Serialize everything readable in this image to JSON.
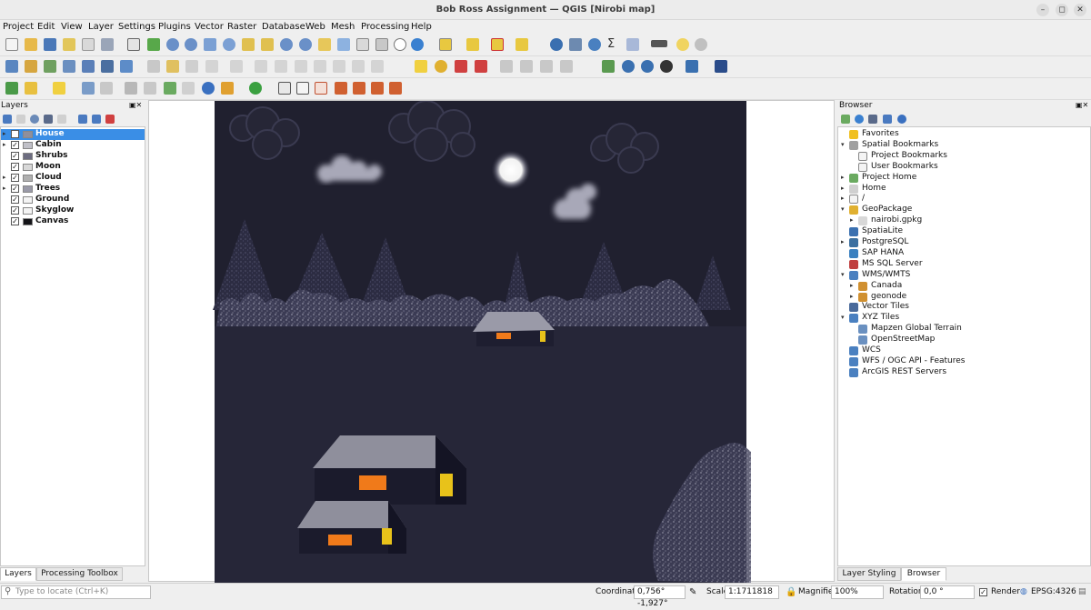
{
  "window": {
    "title": "Bob Ross Assignment — QGIS [Nirobi map]"
  },
  "menu": [
    "Project",
    "Edit",
    "View",
    "Layer",
    "Settings",
    "Plugins",
    "Vector",
    "Raster",
    "Database",
    "Web",
    "Mesh",
    "Processing",
    "Help"
  ],
  "layers_panel": {
    "title": "Layers",
    "items": [
      {
        "name": "House",
        "checked": true,
        "expandable": true,
        "selected": true
      },
      {
        "name": "Cabin",
        "checked": true,
        "expandable": true,
        "selected": false
      },
      {
        "name": "Shrubs",
        "checked": true,
        "expandable": false,
        "selected": false
      },
      {
        "name": "Moon",
        "checked": true,
        "expandable": false,
        "selected": false
      },
      {
        "name": "Cloud",
        "checked": true,
        "expandable": true,
        "selected": false
      },
      {
        "name": "Trees",
        "checked": true,
        "expandable": true,
        "selected": false
      },
      {
        "name": "Ground",
        "checked": true,
        "expandable": false,
        "selected": false
      },
      {
        "name": "Skyglow",
        "checked": true,
        "expandable": false,
        "selected": false
      },
      {
        "name": "Canvas",
        "checked": true,
        "expandable": false,
        "selected": false
      }
    ],
    "tabs": [
      "Layers",
      "Processing Toolbox"
    ]
  },
  "browser_panel": {
    "title": "Browser",
    "items": [
      {
        "label": "Favorites",
        "indent": 0,
        "arrow": "",
        "icon": "star-icon"
      },
      {
        "label": "Spatial Bookmarks",
        "indent": 0,
        "arrow": "▾",
        "icon": "bookmark-icon"
      },
      {
        "label": "Project Bookmarks",
        "indent": 1,
        "arrow": "",
        "icon": "folder-icon"
      },
      {
        "label": "User Bookmarks",
        "indent": 1,
        "arrow": "",
        "icon": "folder-icon"
      },
      {
        "label": "Project Home",
        "indent": 0,
        "arrow": "▸",
        "icon": "project-home-icon"
      },
      {
        "label": "Home",
        "indent": 0,
        "arrow": "▸",
        "icon": "home-icon"
      },
      {
        "label": "/",
        "indent": 0,
        "arrow": "▸",
        "icon": "folder-icon"
      },
      {
        "label": "GeoPackage",
        "indent": 0,
        "arrow": "▾",
        "icon": "geopackage-icon"
      },
      {
        "label": "nairobi.gpkg",
        "indent": 1,
        "arrow": "▸",
        "icon": "database-icon"
      },
      {
        "label": "SpatiaLite",
        "indent": 0,
        "arrow": "",
        "icon": "spatialite-icon"
      },
      {
        "label": "PostgreSQL",
        "indent": 0,
        "arrow": "▸",
        "icon": "postgresql-icon"
      },
      {
        "label": "SAP HANA",
        "indent": 0,
        "arrow": "",
        "icon": "sap-hana-icon"
      },
      {
        "label": "MS SQL Server",
        "indent": 0,
        "arrow": "",
        "icon": "mssql-icon"
      },
      {
        "label": "WMS/WMTS",
        "indent": 0,
        "arrow": "▾",
        "icon": "wms-icon"
      },
      {
        "label": "Canada",
        "indent": 1,
        "arrow": "▸",
        "icon": "connection-icon"
      },
      {
        "label": "geonode",
        "indent": 1,
        "arrow": "▸",
        "icon": "connection-icon"
      },
      {
        "label": "Vector Tiles",
        "indent": 0,
        "arrow": "",
        "icon": "vector-tiles-icon"
      },
      {
        "label": "XYZ Tiles",
        "indent": 0,
        "arrow": "▾",
        "icon": "xyz-tiles-icon"
      },
      {
        "label": "Mapzen Global Terrain",
        "indent": 1,
        "arrow": "",
        "icon": "tiles-icon"
      },
      {
        "label": "OpenStreetMap",
        "indent": 1,
        "arrow": "",
        "icon": "tiles-icon"
      },
      {
        "label": "WCS",
        "indent": 0,
        "arrow": "",
        "icon": "wcs-icon"
      },
      {
        "label": "WFS / OGC API - Features",
        "indent": 0,
        "arrow": "",
        "icon": "wfs-icon"
      },
      {
        "label": "ArcGIS REST Servers",
        "indent": 0,
        "arrow": "",
        "icon": "arcgis-icon"
      }
    ],
    "tabs": [
      "Layer Styling",
      "Browser"
    ]
  },
  "statusbar": {
    "locate_placeholder": "Type to locate (Ctrl+K)",
    "coordinate_label": "Coordinate",
    "coordinate_value": "0,756° -1,927°",
    "scale_label": "Scale",
    "scale_value": "1:1711818",
    "magnifier_label": "Magnifier",
    "magnifier_value": "100%",
    "rotation_label": "Rotation",
    "rotation_value": "0,0 °",
    "render_label": "Render",
    "crs": "EPSG:4326"
  },
  "colors": {
    "night_sky": "#20202f",
    "selection": "#3a8ee6",
    "window_glow": "#f07a1a",
    "window_yellow": "#e8c21a"
  }
}
